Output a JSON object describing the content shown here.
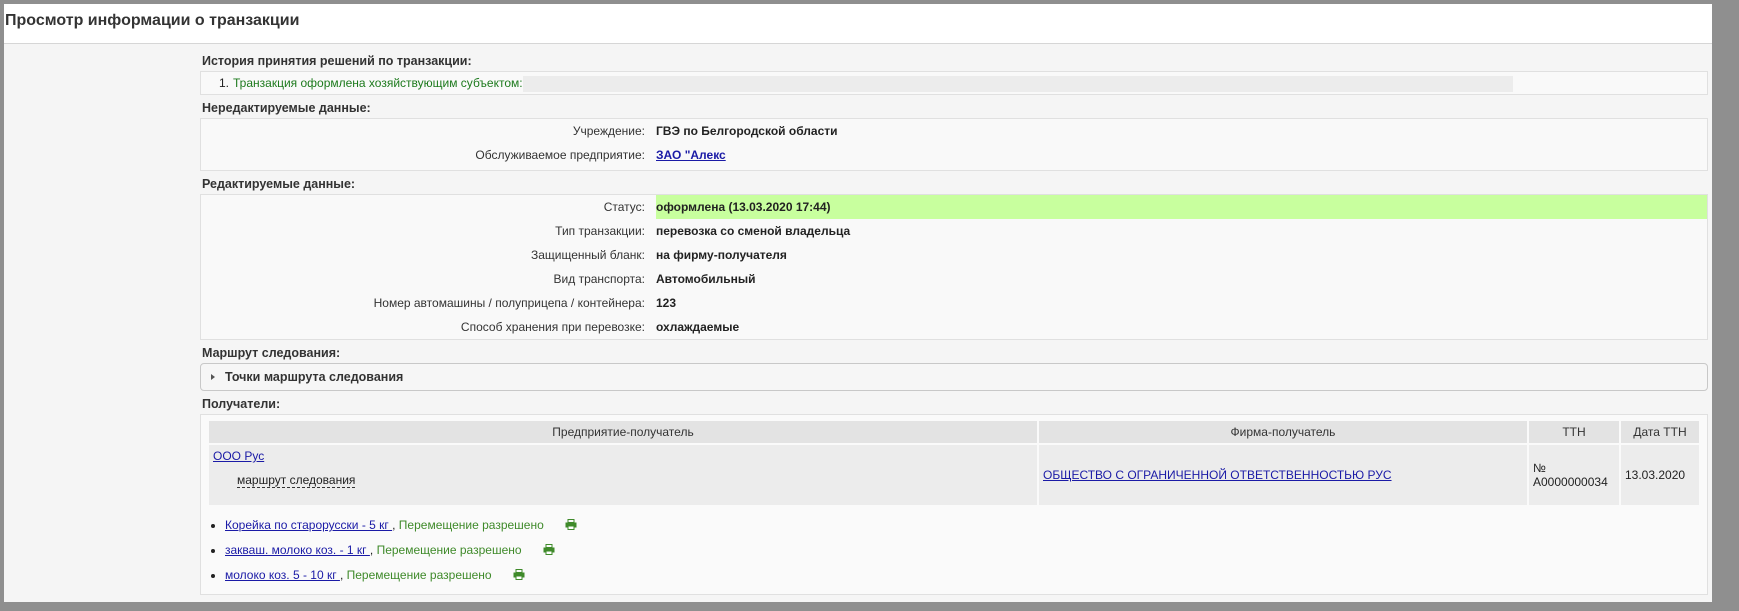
{
  "page": {
    "title": "Просмотр информации о транзакции"
  },
  "history": {
    "title": "История принятия решений по транзакции:",
    "items": [
      {
        "number": "1.",
        "text": "Транзакция оформлена хозяйствующим субъектом:"
      }
    ]
  },
  "noneditable": {
    "title": "Нередактируемые данные:",
    "rows": [
      {
        "label": "Учреждение:",
        "value": "ГВЭ по Белгородской области"
      },
      {
        "label": "Обслуживаемое предприятие:",
        "value": "ЗАО \"Алекс"
      }
    ]
  },
  "editable": {
    "title": "Редактируемые данные:",
    "rows": [
      {
        "label": "Статус:",
        "value": "оформлена (13.03.2020 17:44)"
      },
      {
        "label": "Тип транзакции:",
        "value": "перевозка со сменой владельца"
      },
      {
        "label": "Защищенный бланк:",
        "value": "на фирму-получателя"
      },
      {
        "label": "Вид транспорта:",
        "value": "Автомобильный"
      },
      {
        "label": "Номер автомашины / полуприцепа / контейнера:",
        "value": "123"
      },
      {
        "label": "Способ хранения при перевозке:",
        "value": "охлаждаемые"
      }
    ]
  },
  "route": {
    "title": "Маршрут следования:",
    "panel_label": "Точки маршрута следования"
  },
  "recipients": {
    "title": "Получатели:",
    "columns": [
      "Предприятие-получатель",
      "Фирма-получатель",
      "ТТН",
      "Дата ТТН"
    ],
    "row": {
      "enterprise": "ООО Рус",
      "route_label": "маршрут следования",
      "firm": "ОБЩЕСТВО С ОГРАНИЧЕННОЙ ОТВЕТСТВЕННОСТЬЮ  РУС",
      "ttn": "№ A0000000034",
      "ttn_date": "13.03.2020"
    },
    "products": [
      {
        "name": "Корейка по старорусски - 5 кг ",
        "status": "Перемещение разрешено"
      },
      {
        "name": "закваш. молоко коз. - 1 кг ",
        "status": "Перемещение разрешено"
      },
      {
        "name": "молоко коз. 5 - 10 кг ",
        "status": "Перемещение разрешено"
      }
    ]
  },
  "colors": {
    "status_highlight": "#c8ff9e",
    "permitted": "#3f8a2a",
    "link": "#1a1aa6",
    "history_text": "#1d7a1d"
  },
  "icons": {
    "print": "printer-icon",
    "expand": "triangle-right-icon"
  }
}
